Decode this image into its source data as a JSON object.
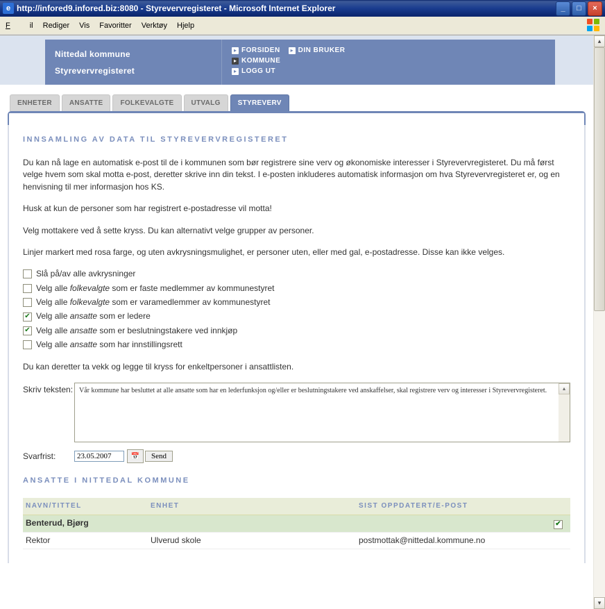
{
  "window": {
    "title": "http://infored9.infored.biz:8080 - Styrevervregisteret - Microsoft Internet Explorer"
  },
  "menu": {
    "fil": "Fil",
    "rediger": "Rediger",
    "vis": "Vis",
    "favoritter": "Favoritter",
    "verktoy": "Verktøy",
    "hjelp": "Hjelp"
  },
  "banner": {
    "kommune": "Nittedal kommune",
    "register": "Styrevervregisteret"
  },
  "nav": {
    "forsiden": "FORSIDEN",
    "dinbruker": "DIN BRUKER",
    "kommune": "KOMMUNE",
    "loggut": "LOGG UT"
  },
  "tabs": {
    "enheter": "ENHETER",
    "ansatte": "ANSATTE",
    "folkevalgte": "FOLKEVALGTE",
    "utvalg": "UTVALG",
    "styreverv": "STYREVERV"
  },
  "section1_title": "INNSAMLING AV DATA TIL STYREVERVREGISTERET",
  "para1": "Du kan nå lage en automatisk e-post til de i kommunen som bør registrere sine verv og økonomiske interesser i Styrevervregisteret. Du må først velge hvem som skal motta e-post, deretter skrive inn din tekst. I e-posten inkluderes automatisk informasjon om hva Styrevervregisteret er, og en henvisning til mer informasjon hos KS.",
  "para2": "Husk at kun de personer som har registrert e-postadresse vil motta!",
  "para3": "Velg mottakere ved å sette kryss. Du kan alternativt velge grupper av personer.",
  "para4": "Linjer markert med rosa farge, og uten avkrysningsmulighet, er personer uten, eller med gal, e-postadresse. Disse kan ikke velges.",
  "check1_a": "Slå på/av alle avkrysninger",
  "check2_a": "Velg alle ",
  "check2_b": "folkevalgte",
  "check2_c": " som er faste medlemmer av kommunestyret",
  "check3_a": "Velg alle ",
  "check3_b": "folkevalgte",
  "check3_c": " som er varamedlemmer av kommunestyret",
  "check4_a": "Velg alle ",
  "check4_b": "ansatte",
  "check4_c": " som er ledere",
  "check5_a": "Velg alle ",
  "check5_b": "ansatte",
  "check5_c": " som er beslutningstakere ved innkjøp",
  "check6_a": "Velg alle ",
  "check6_b": "ansatte",
  "check6_c": " som har innstillingsrett",
  "para5": "Du kan deretter ta vekk og legge til kryss for enkeltpersoner i ansattlisten.",
  "form": {
    "skriv_label": "Skriv teksten:",
    "textarea_value": "Vår kommune har besluttet at alle ansatte som har en lederfunksjon og/eller er beslutningstakere ved anskaffelser, skal registrere verv og interesser i Styrevervregisteret.",
    "svarfrist_label": "Svarfrist:",
    "date_value": "23.05.2007",
    "send_label": "Send"
  },
  "section2_title": "ANSATTE I NITTEDAL KOMMUNE",
  "table": {
    "h1": "NAVN/TITTEL",
    "h2": "ENHET",
    "h3": "SIST OPPDATERT/E-POST",
    "rows": [
      {
        "navn": "Benterud, Bjørg",
        "enhet": "",
        "sist": "",
        "hl": true,
        "chk": true
      },
      {
        "navn": "Rektor",
        "enhet": "Ulverud skole",
        "sist": "postmottak@nittedal.kommune.no",
        "hl": false,
        "chk": false
      }
    ]
  }
}
